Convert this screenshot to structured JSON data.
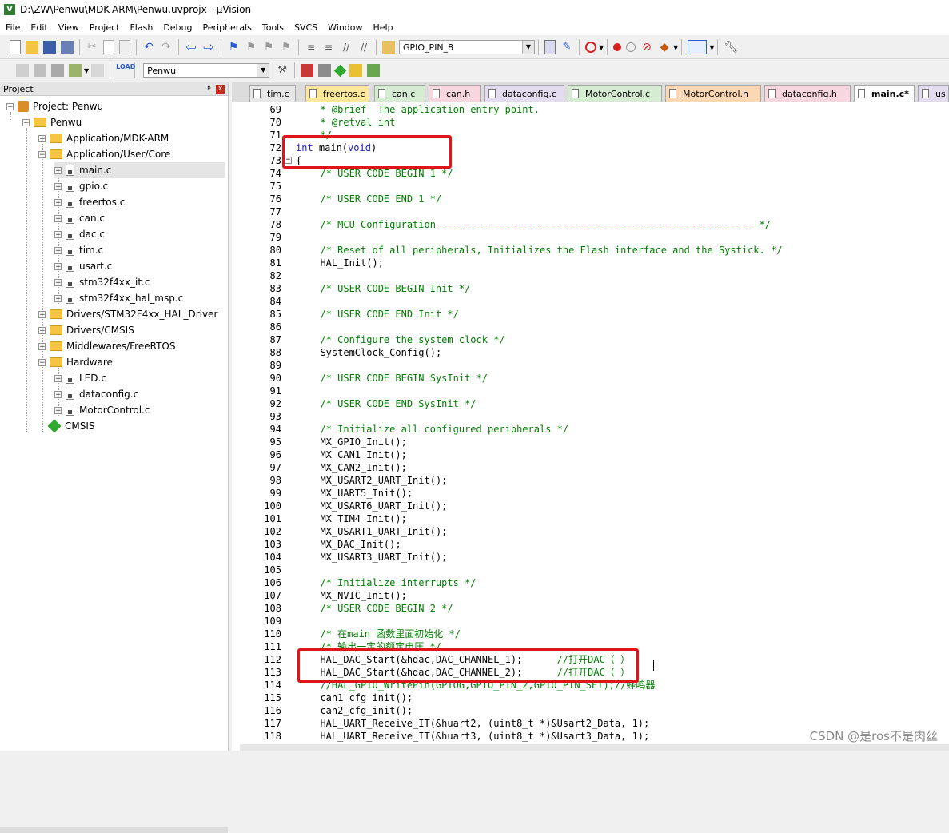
{
  "window": {
    "title": "D:\\ZW\\Penwu\\MDK-ARM\\Penwu.uvprojx - µVision",
    "app_icon": "uvision-icon"
  },
  "menu": [
    "File",
    "Edit",
    "View",
    "Project",
    "Flash",
    "Debug",
    "Peripherals",
    "Tools",
    "SVCS",
    "Window",
    "Help"
  ],
  "toolbar": {
    "find_combo_value": "GPIO_PIN_8",
    "target_combo_value": "Penwu"
  },
  "project_panel": {
    "title": "Project",
    "pin_glyph": "ᵖ",
    "close_glyph": "x",
    "tree": {
      "root": "Project: Penwu",
      "target": "Penwu",
      "group_mdk": "Application/MDK-ARM",
      "group_core": "Application/User/Core",
      "core_files": [
        "main.c",
        "gpio.c",
        "freertos.c",
        "can.c",
        "dac.c",
        "tim.c",
        "usart.c",
        "stm32f4xx_it.c",
        "stm32f4xx_hal_msp.c"
      ],
      "group_hal": "Drivers/STM32F4xx_HAL_Driver",
      "group_cmsis_drv": "Drivers/CMSIS",
      "group_rtos": "Middlewares/FreeRTOS",
      "group_hw": "Hardware",
      "hw_files": [
        "LED.c",
        "dataconfig.c",
        "MotorControl.c"
      ],
      "cmsis": "CMSIS"
    }
  },
  "tabs": [
    {
      "label": "tim.c",
      "color": "#e7e7e7"
    },
    {
      "label": "freertos.c",
      "color": "#fde79a"
    },
    {
      "label": "can.c",
      "color": "#d6ecd2"
    },
    {
      "label": "can.h",
      "color": "#f7d6e0"
    },
    {
      "label": "dataconfig.c",
      "color": "#e3dcf1"
    },
    {
      "label": "MotorControl.c",
      "color": "#d6ecd2"
    },
    {
      "label": "MotorControl.h",
      "color": "#fbd8b3"
    },
    {
      "label": "dataconfig.h",
      "color": "#f7d6e0"
    },
    {
      "label": "main.c*",
      "color": "#ffffff"
    },
    {
      "label": "us",
      "color": "#e3dcf1"
    }
  ],
  "code": [
    {
      "n": "69",
      "t": "  * @brief  The application entry point.",
      "k": "com"
    },
    {
      "n": "70",
      "t": "  * @retval int",
      "k": "com"
    },
    {
      "n": "71",
      "t": "  */",
      "k": "com"
    },
    {
      "n": "72",
      "t": "int main(void)",
      "k": "main"
    },
    {
      "n": "73",
      "t": "{",
      "k": "txt"
    },
    {
      "n": "74",
      "t": "  /* USER CODE BEGIN 1 */",
      "k": "com"
    },
    {
      "n": "75",
      "t": "",
      "k": "txt"
    },
    {
      "n": "76",
      "t": "  /* USER CODE END 1 */",
      "k": "com"
    },
    {
      "n": "77",
      "t": "",
      "k": "txt"
    },
    {
      "n": "78",
      "t": "  /* MCU Configuration--------------------------------------------------------*/",
      "k": "com"
    },
    {
      "n": "79",
      "t": "",
      "k": "txt"
    },
    {
      "n": "80",
      "t": "  /* Reset of all peripherals, Initializes the Flash interface and the Systick. */",
      "k": "com"
    },
    {
      "n": "81",
      "t": "  HAL_Init();",
      "k": "txt"
    },
    {
      "n": "82",
      "t": "",
      "k": "txt"
    },
    {
      "n": "83",
      "t": "  /* USER CODE BEGIN Init */",
      "k": "com"
    },
    {
      "n": "84",
      "t": "",
      "k": "txt"
    },
    {
      "n": "85",
      "t": "  /* USER CODE END Init */",
      "k": "com"
    },
    {
      "n": "86",
      "t": "",
      "k": "txt"
    },
    {
      "n": "87",
      "t": "  /* Configure the system clock */",
      "k": "com"
    },
    {
      "n": "88",
      "t": "  SystemClock_Config();",
      "k": "txt"
    },
    {
      "n": "89",
      "t": "",
      "k": "txt"
    },
    {
      "n": "90",
      "t": "  /* USER CODE BEGIN SysInit */",
      "k": "com"
    },
    {
      "n": "91",
      "t": "",
      "k": "txt"
    },
    {
      "n": "92",
      "t": "  /* USER CODE END SysInit */",
      "k": "com"
    },
    {
      "n": "93",
      "t": "",
      "k": "txt"
    },
    {
      "n": "94",
      "t": "  /* Initialize all configured peripherals */",
      "k": "com"
    },
    {
      "n": "95",
      "t": "  MX_GPIO_Init();",
      "k": "txt"
    },
    {
      "n": "96",
      "t": "  MX_CAN1_Init();",
      "k": "txt"
    },
    {
      "n": "97",
      "t": "  MX_CAN2_Init();",
      "k": "txt"
    },
    {
      "n": "98",
      "t": "  MX_USART2_UART_Init();",
      "k": "txt"
    },
    {
      "n": "99",
      "t": "  MX_UART5_Init();",
      "k": "txt"
    },
    {
      "n": "100",
      "t": "  MX_USART6_UART_Init();",
      "k": "txt"
    },
    {
      "n": "101",
      "t": "  MX_TIM4_Init();",
      "k": "txt"
    },
    {
      "n": "102",
      "t": "  MX_USART1_UART_Init();",
      "k": "txt"
    },
    {
      "n": "103",
      "t": "  MX_DAC_Init();",
      "k": "txt"
    },
    {
      "n": "104",
      "t": "  MX_USART3_UART_Init();",
      "k": "txt"
    },
    {
      "n": "105",
      "t": "",
      "k": "txt"
    },
    {
      "n": "106",
      "t": "  /* Initialize interrupts */",
      "k": "com"
    },
    {
      "n": "107",
      "t": "  MX_NVIC_Init();",
      "k": "txt"
    },
    {
      "n": "108",
      "t": "  /* USER CODE BEGIN 2 */",
      "k": "com"
    },
    {
      "n": "109",
      "t": "",
      "k": "txt"
    },
    {
      "n": "110",
      "t": "  /* 在main 函数里面初始化 */",
      "k": "com"
    },
    {
      "n": "111",
      "t": "  /* 输出一定的额定电压 */",
      "k": "com"
    },
    {
      "n": "112",
      "t": "  HAL_DAC_Start(&hdac,DAC_CHANNEL_1);      ",
      "k": "dac",
      "c": "//打开DAC（ ）"
    },
    {
      "n": "113",
      "t": "  HAL_DAC_Start(&hdac,DAC_CHANNEL_2);      ",
      "k": "dac",
      "c": "//打开DAC（ ）"
    },
    {
      "n": "114",
      "t": "  //HAL_GPIO_WritePin(GPIOG,GPIO_PIN_2,GPIO_PIN_SET);//蜂鸣器",
      "k": "com"
    },
    {
      "n": "115",
      "t": "  can1_cfg_init();",
      "k": "txt"
    },
    {
      "n": "116",
      "t": "  can2_cfg_init();",
      "k": "txt"
    },
    {
      "n": "117",
      "t": "  HAL_UART_Receive_IT(&huart2, (uint8_t *)&Usart2_Data, 1);",
      "k": "txt"
    },
    {
      "n": "118",
      "t": "  HAL_UART_Receive_IT(&huart3, (uint8_t *)&Usart3_Data, 1);",
      "k": "txt"
    }
  ],
  "watermark": "CSDN @是ros不是肉丝"
}
